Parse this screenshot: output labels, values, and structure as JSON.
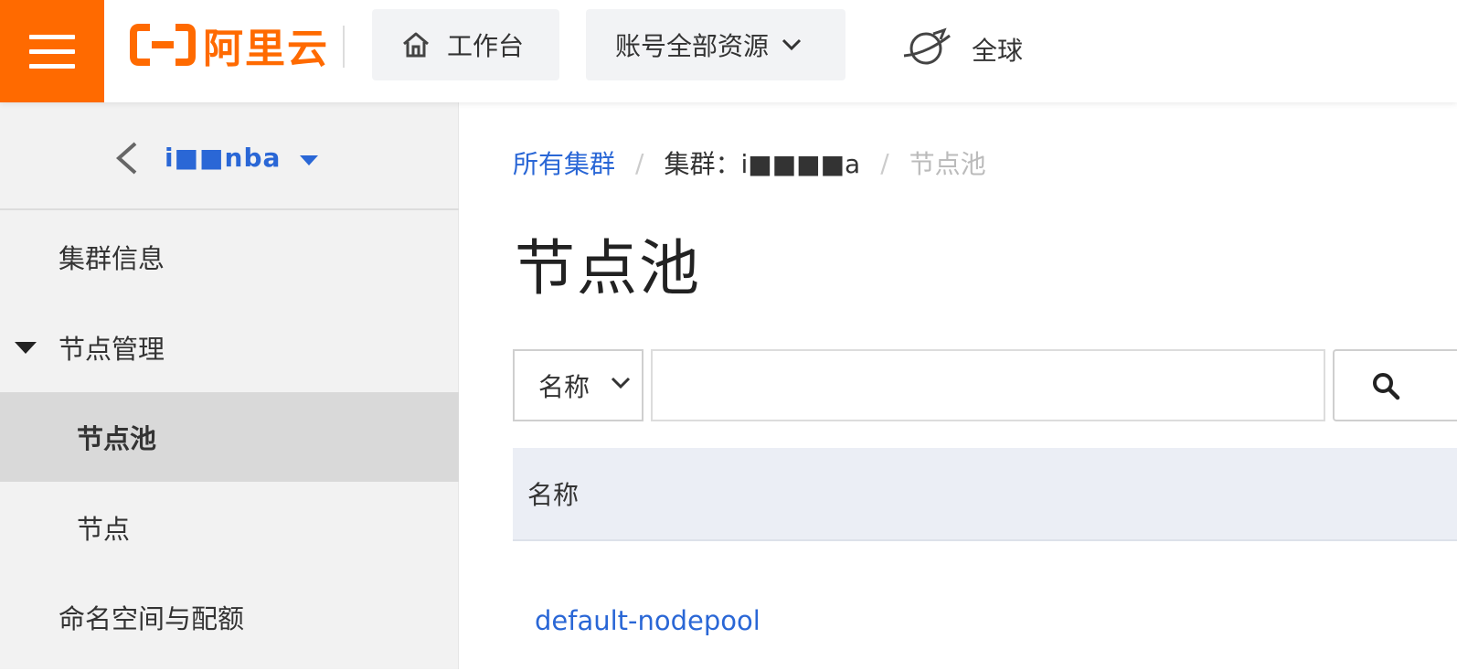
{
  "topbar": {
    "logo_text": "阿里云",
    "workbench_label": "工作台",
    "resources_label": "账号全部资源",
    "region_label": "全球"
  },
  "sidebar": {
    "cluster_name": "i■■nba",
    "items": [
      {
        "label": "集群信息"
      },
      {
        "label": "节点管理"
      },
      {
        "label": "节点池"
      },
      {
        "label": "节点"
      },
      {
        "label": "命名空间与配额"
      }
    ]
  },
  "breadcrumb": {
    "all_clusters": "所有集群",
    "cluster": "集群：i■■■■a",
    "current": "节点池",
    "separator": "/"
  },
  "page": {
    "title": "节点池"
  },
  "filter": {
    "select_value": "名称",
    "search_placeholder": ""
  },
  "table": {
    "columns": [
      "名称"
    ],
    "rows": [
      {
        "name": "default-nodepool"
      }
    ]
  },
  "colors": {
    "brand": "#ff6a00",
    "link": "#2a67d6",
    "active_bg": "#d9d9d9"
  }
}
